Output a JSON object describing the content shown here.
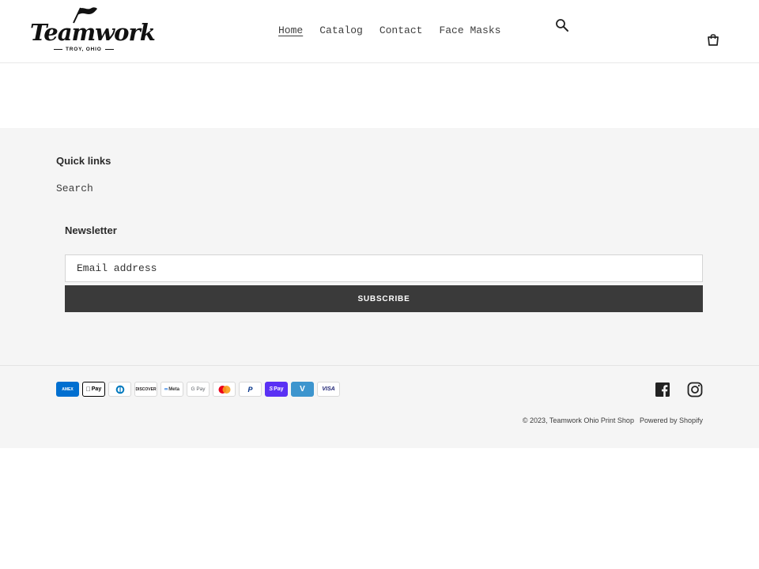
{
  "brand": {
    "name": "Teamwork",
    "location": "TROY, OHIO"
  },
  "nav": {
    "items": [
      {
        "label": "Home",
        "active": true
      },
      {
        "label": "Catalog",
        "active": false
      },
      {
        "label": "Contact",
        "active": false
      },
      {
        "label": "Face Masks",
        "active": false
      }
    ]
  },
  "header_icons": {
    "search": "search-icon",
    "cart": "cart-icon"
  },
  "footer": {
    "quick_links": {
      "title": "Quick links",
      "items": [
        "Search"
      ]
    },
    "newsletter": {
      "title": "Newsletter",
      "email_placeholder": "Email address",
      "subscribe_label": "SUBSCRIBE"
    },
    "payment_methods": [
      {
        "name": "American Express",
        "label": "AMEX",
        "color": "#016fd0"
      },
      {
        "name": "Apple Pay",
        "label": "Pay",
        "color": "#000000"
      },
      {
        "name": "Diners Club",
        "label": "D",
        "color": "#0079be"
      },
      {
        "name": "Discover",
        "label": "DISCOVER",
        "color": "#231f20"
      },
      {
        "name": "Meta Pay",
        "label": "Meta",
        "color": "#333333"
      },
      {
        "name": "Google Pay",
        "label": "G Pay",
        "color": "#5f6368"
      },
      {
        "name": "Mastercard",
        "label": "",
        "color": "#eb001b"
      },
      {
        "name": "PayPal",
        "label": "P",
        "color": "#003087"
      },
      {
        "name": "Shop Pay",
        "label": "Pay",
        "color": "#5a31f4"
      },
      {
        "name": "Venmo",
        "label": "V",
        "color": "#3d95ce"
      },
      {
        "name": "Visa",
        "label": "VISA",
        "color": "#1a1f71"
      }
    ],
    "social": [
      "facebook-icon",
      "instagram-icon"
    ],
    "copyright": "© 2023, Teamwork Ohio Print Shop",
    "powered_by": "Powered by Shopify"
  },
  "colors": {
    "footer_bg": "#f5f5f5",
    "button_bg": "#3a3a3a",
    "text": "#3d3d3d"
  }
}
